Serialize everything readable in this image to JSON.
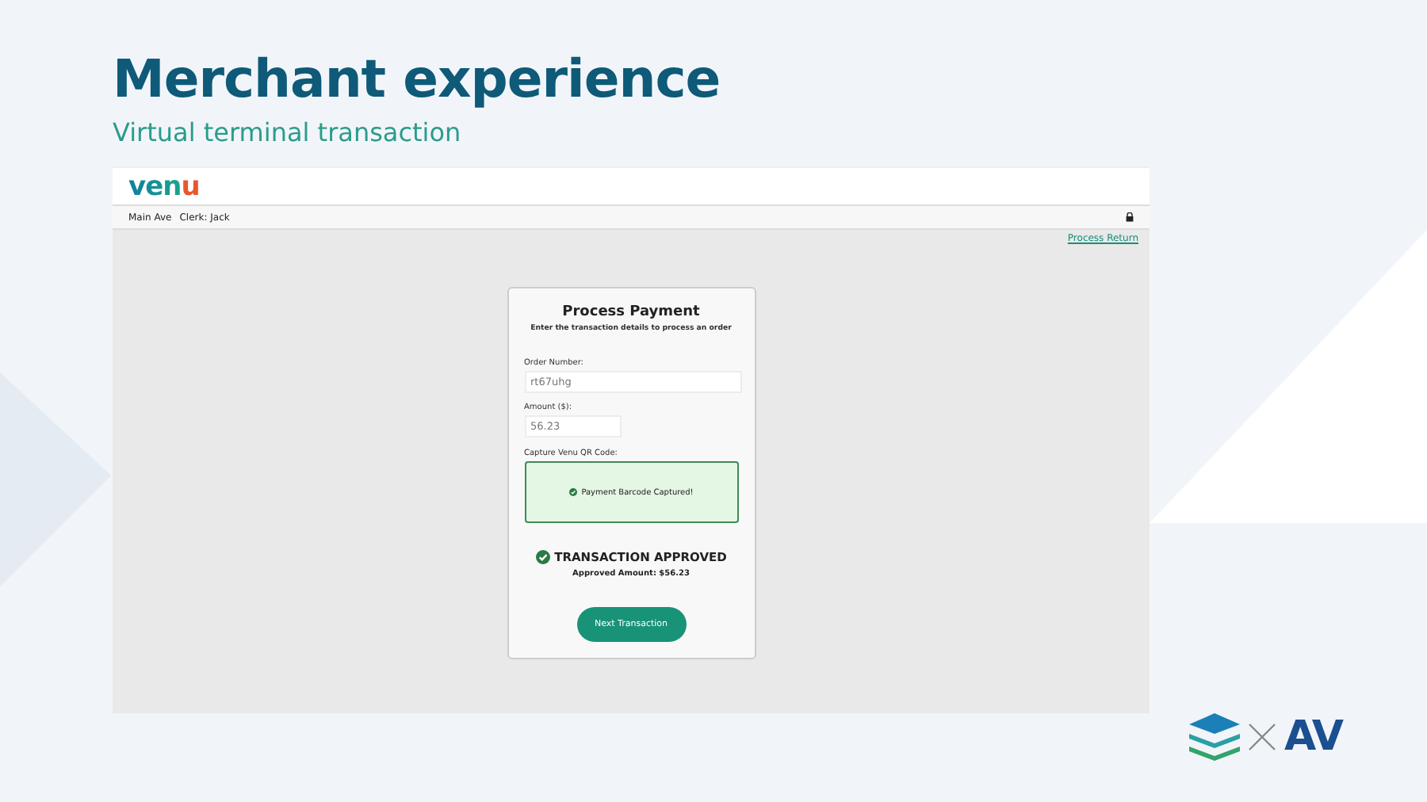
{
  "slide": {
    "title": "Merchant experience",
    "subtitle": "Virtual terminal transaction"
  },
  "app": {
    "logo": "venu",
    "store": "Main Ave",
    "clerk": "Clerk: Jack",
    "process_return": "Process Return",
    "card": {
      "title": "Process Payment",
      "instructions": "Enter the transaction details to process an order",
      "fields": [
        {
          "label": "Order Number:",
          "value": "rt67uhg"
        },
        {
          "label": "Amount ($):",
          "value": "56.23"
        }
      ],
      "capture_label": "Capture Venu QR Code:",
      "capture_status": "Payment Barcode Captured!",
      "result": "TRANSACTION APPROVED",
      "approved_amount": "Approved Amount: $56.23",
      "button": "Next Transaction"
    }
  },
  "brand": {
    "text": "AV"
  }
}
